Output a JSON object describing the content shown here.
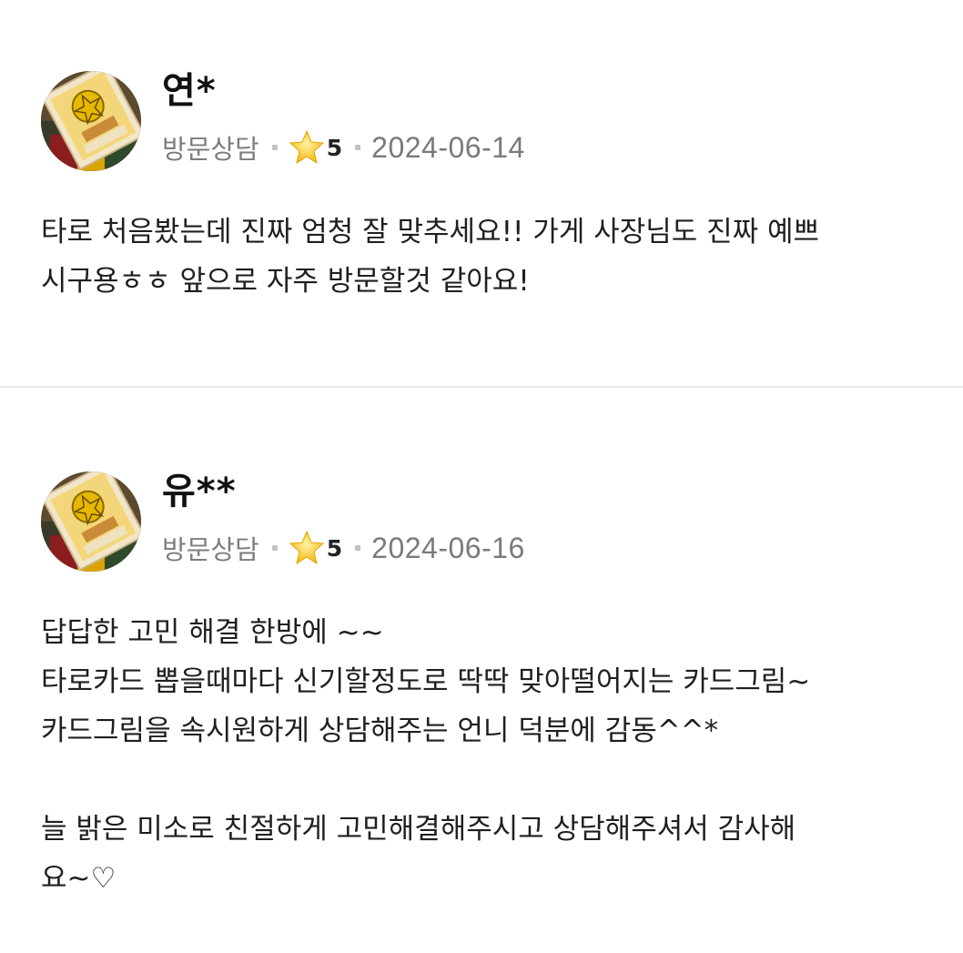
{
  "reviews": [
    {
      "name": "연*",
      "visit_type": "방문상담",
      "rating": "5",
      "date": "2024-06-14",
      "text": "타로 처음봤는데 진짜 엄청 잘 맞추세요!! 가게 사장님도 진짜 예쁘\n시구용ㅎㅎ 앞으로 자주 방문할것 같아요!"
    },
    {
      "name": "유**",
      "visit_type": "방문상담",
      "rating": "5",
      "date": "2024-06-16",
      "text": "답답한 고민 해결 한방에 ~~\n타로카드 뽑을때마다 신기할정도로 딱딱 맞아떨어지는 카드그림~\n카드그림을 속시원하게 상담해주는 언니 덕분에 감동^^*\n\n늘 밝은 미소로 친절하게 고민해결해주시고 상담해주셔서 감사해\n요~♡"
    }
  ],
  "icons": {
    "rating": "star-icon",
    "avatar": "tarot-card-image"
  },
  "colors": {
    "star": "#f7c948",
    "meta_text": "#7d7d7d",
    "divider": "#ebebeb"
  }
}
